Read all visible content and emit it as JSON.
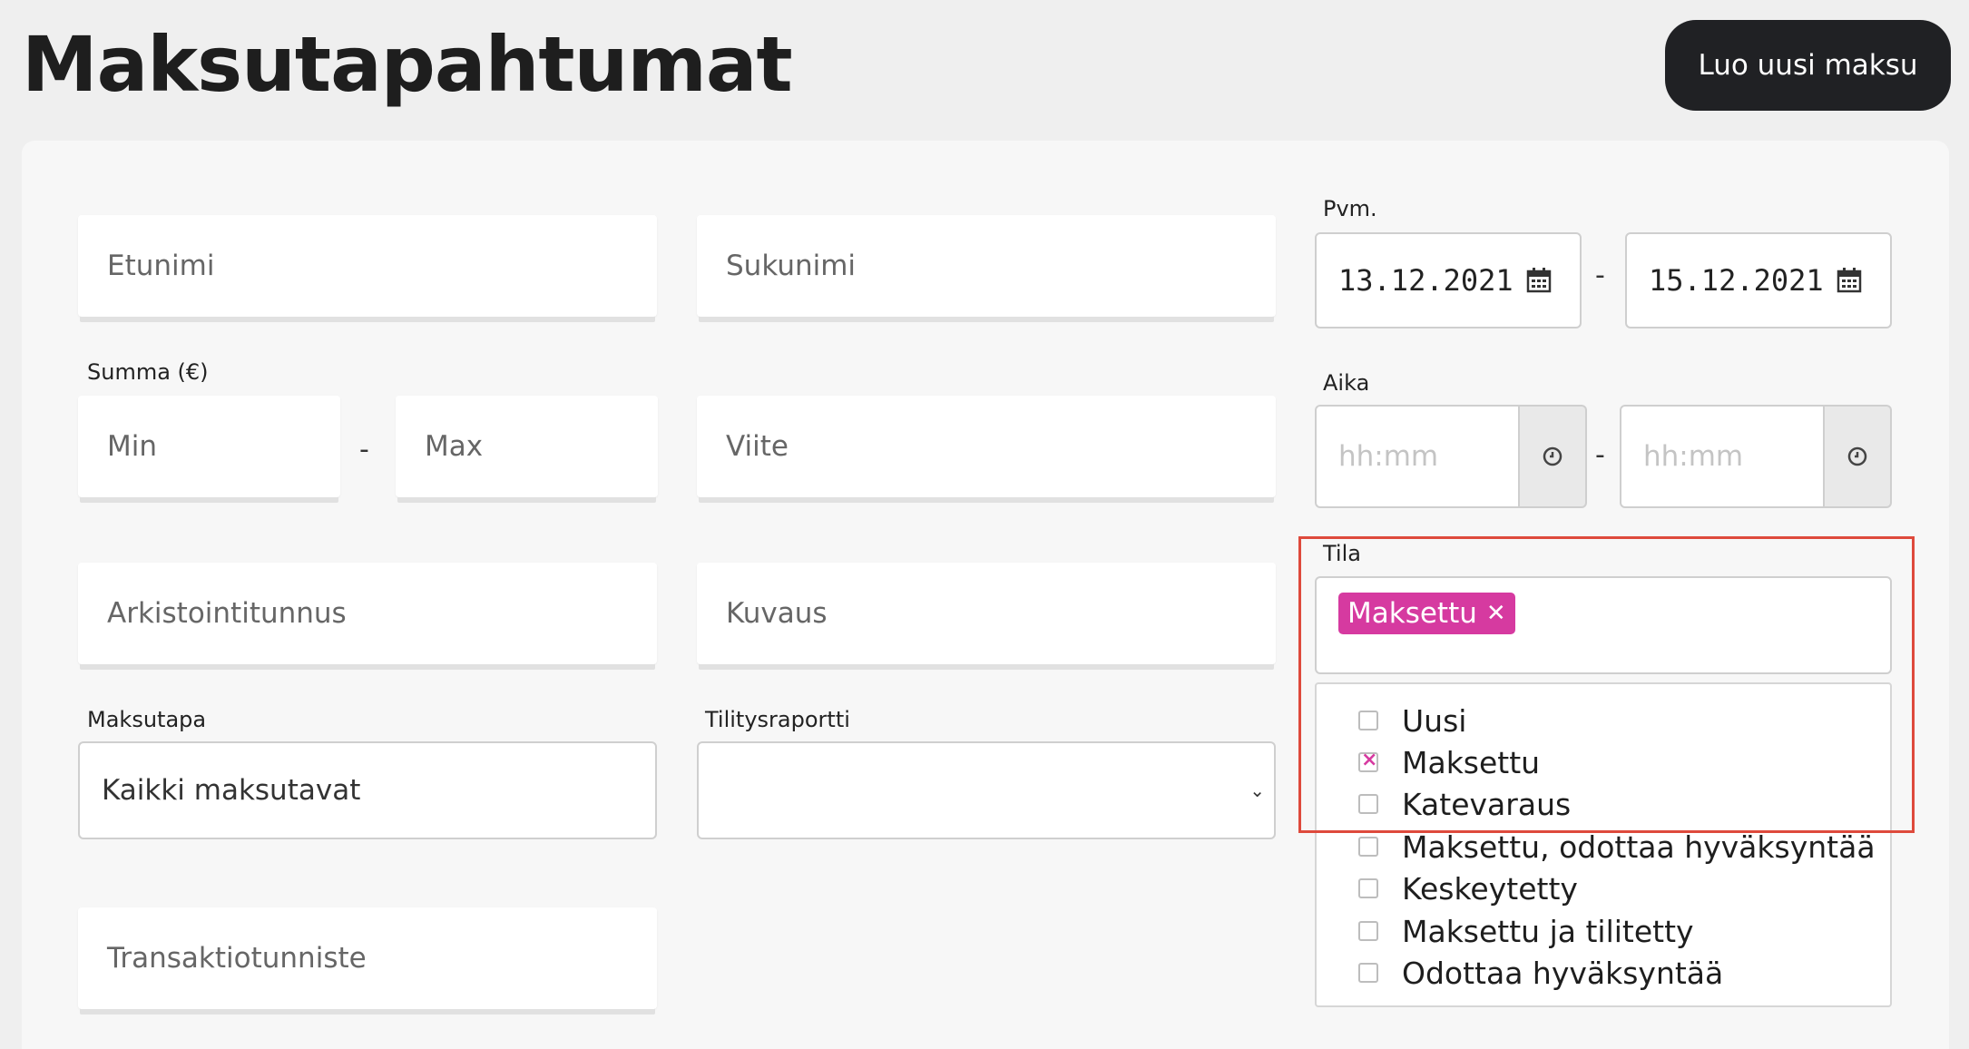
{
  "page": {
    "title": "Maksutapahtumat",
    "new_payment_label": "Luo uusi maksu"
  },
  "filters": {
    "first_name_placeholder": "Etunimi",
    "last_name_placeholder": "Sukunimi",
    "amount_label": "Summa (€)",
    "min_placeholder": "Min",
    "max_placeholder": "Max",
    "reference_placeholder": "Viite",
    "archive_id_placeholder": "Arkistointitunnus",
    "description_placeholder": "Kuvaus",
    "payment_method_label": "Maksutapa",
    "payment_method_value": "Kaikki maksutavat",
    "settlement_report_label": "Tilitysraportti",
    "settlement_report_value": "",
    "transaction_id_placeholder": "Transaktiotunniste",
    "range_separator": "-",
    "date_label": "Pvm.",
    "date_from": "13.12.2021",
    "date_to": "15.12.2021",
    "time_label": "Aika",
    "time_from_placeholder": "hh:mm",
    "time_to_placeholder": "hh:mm",
    "status_label": "Tila",
    "status_selected_tag": "Maksettu",
    "status_options": [
      {
        "label": "Uusi",
        "checked": false
      },
      {
        "label": "Maksettu",
        "checked": true
      },
      {
        "label": "Katevaraus",
        "checked": false
      },
      {
        "label": "Maksettu, odottaa hyväksyntää",
        "checked": false
      },
      {
        "label": "Keskeytetty",
        "checked": false
      },
      {
        "label": "Maksettu ja tilitetty",
        "checked": false
      },
      {
        "label": "Odottaa hyväksyntää",
        "checked": false
      }
    ]
  },
  "colors": {
    "accent": "#d63aa0",
    "highlight": "#de4a3c",
    "button_bg": "#202124"
  },
  "icons": {
    "calendar": "calendar-icon",
    "clock": "clock-icon",
    "chevron": "chevron-down-icon",
    "remove": "close-icon"
  }
}
